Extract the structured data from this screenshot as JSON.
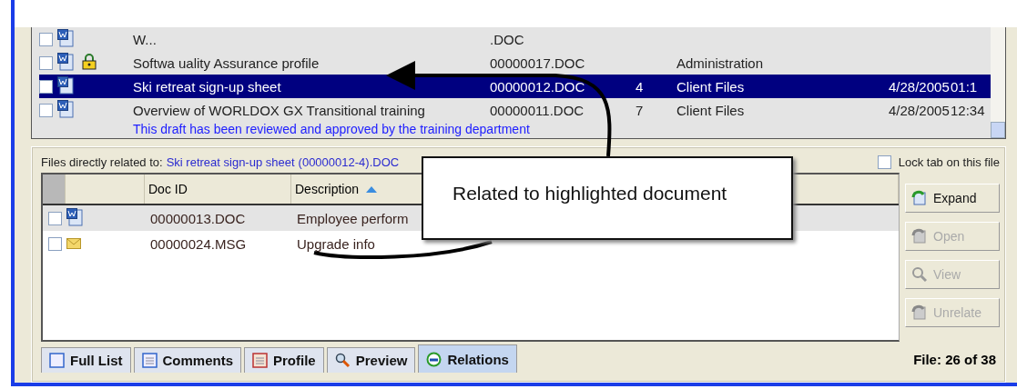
{
  "file_list": {
    "rows": [
      {
        "checked": false,
        "kind": "doc",
        "locked": false,
        "selected": false,
        "description": "W...",
        "doc_id": ".DOC",
        "version": "",
        "category": "",
        "date": "",
        "time": ""
      },
      {
        "checked": false,
        "kind": "doc",
        "locked": true,
        "selected": false,
        "description": "Softwa uality Assurance profile",
        "doc_id": "00000017.DOC",
        "version": "",
        "category": "Administration",
        "date": "",
        "time": ""
      },
      {
        "checked": false,
        "kind": "doc",
        "locked": false,
        "selected": true,
        "description": "Ski retreat sign-up sheet",
        "doc_id": "00000012.DOC",
        "version": "4",
        "category": "Client Files",
        "date": "4/28/2005",
        "time": "01:1"
      },
      {
        "checked": false,
        "kind": "doc",
        "locked": false,
        "selected": false,
        "description": "Overview of WORLDOX GX Transitional training",
        "doc_id": "00000011.DOC",
        "version": "7",
        "category": "Client Files",
        "date": "4/28/2005",
        "time": "12:34",
        "comment": "This draft has been reviewed and approved by the training department"
      }
    ]
  },
  "relations": {
    "label": "Files directly related to:",
    "file_title": "Ski retreat sign-up sheet",
    "file_ref": "(00000012-4).DOC",
    "lock": {
      "label": "Lock tab on this file",
      "checked": false
    },
    "columns": [
      {
        "label": "Doc ID",
        "sorted": false
      },
      {
        "label": "Description",
        "sorted": true
      }
    ],
    "rows": [
      {
        "checked": false,
        "kind": "doc",
        "selected": true,
        "doc_id": "00000013.DOC",
        "description": "Employee perform"
      },
      {
        "checked": false,
        "kind": "msg",
        "selected": false,
        "doc_id": "00000024.MSG",
        "description": "Upgrade info"
      }
    ],
    "buttons": [
      {
        "label": "Expand",
        "disabled": false
      },
      {
        "label": "Open",
        "disabled": true
      },
      {
        "label": "View",
        "disabled": true
      },
      {
        "label": "Unrelate",
        "disabled": true
      }
    ]
  },
  "callout": {
    "text": "Related to highlighted document"
  },
  "tabs": [
    {
      "label": "Full List",
      "selected": false
    },
    {
      "label": "Comments",
      "selected": false
    },
    {
      "label": "Profile",
      "selected": false
    },
    {
      "label": "Preview",
      "selected": false
    },
    {
      "label": "Relations",
      "selected": true
    }
  ],
  "status": "File: 26 of 38"
}
